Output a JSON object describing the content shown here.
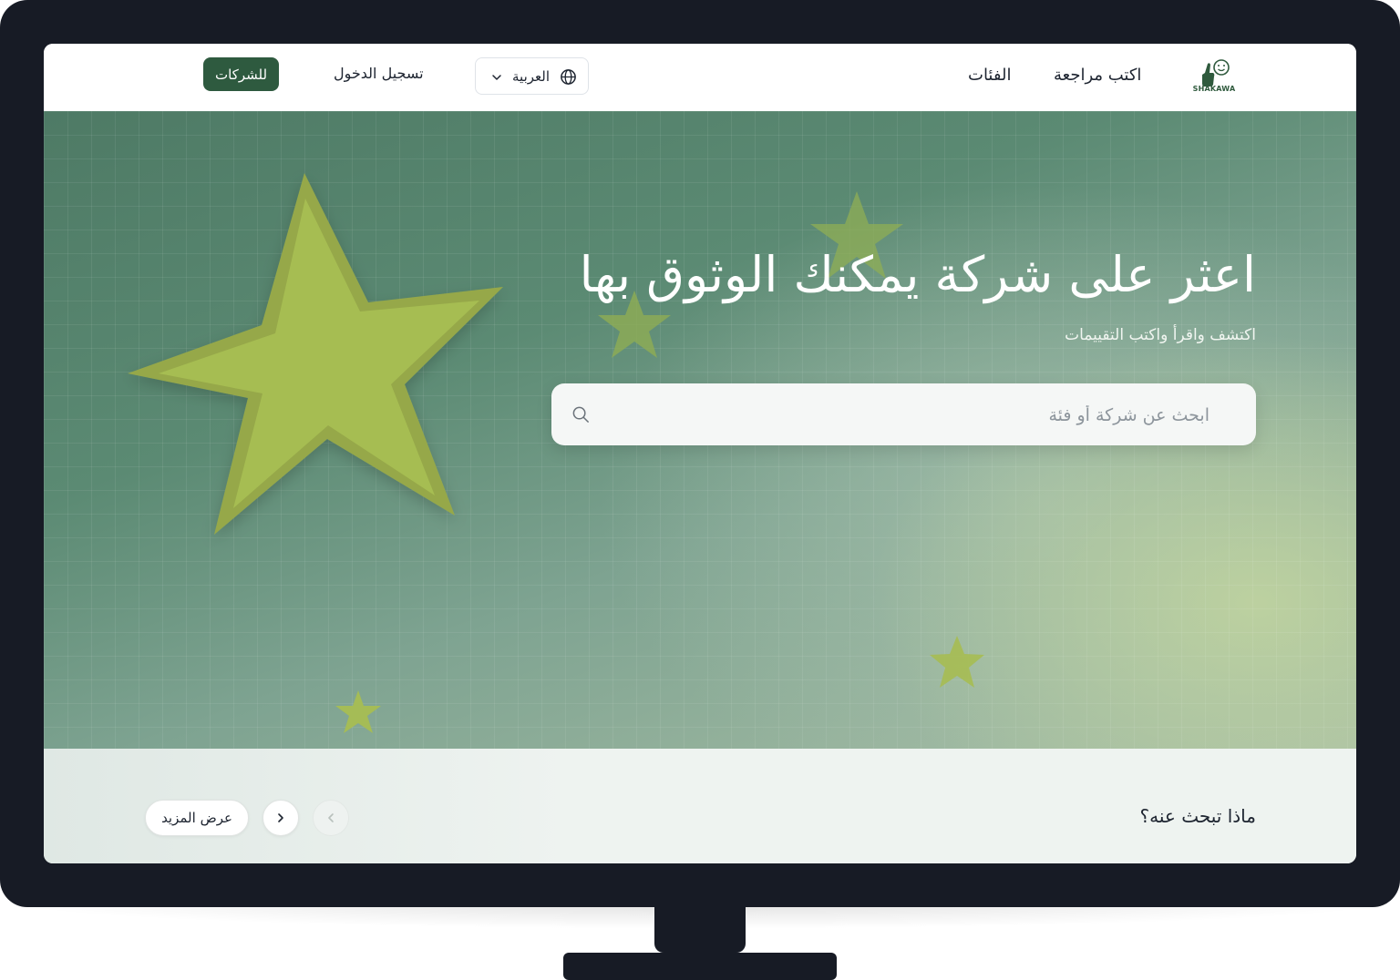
{
  "logo": {
    "text": "SHAKAWA"
  },
  "nav": {
    "write_review": "اكتب مراجعة",
    "categories": "الفئات",
    "language": "العربية",
    "login": "تسجيل الدخول",
    "for_business": "للشركات"
  },
  "hero": {
    "title": "اعثر على شركة يمكنك الوثوق بها",
    "subtitle": "اكتشف واقرأ واكتب التقييمات",
    "search_placeholder": "ابحث عن شركة أو فئة"
  },
  "section": {
    "title": "ماذا تبحث عنه؟",
    "more_label": "عرض المزيد"
  },
  "colors": {
    "brand": "#2e5a3f",
    "star": "#a6bd52",
    "monitor": "#171b25"
  },
  "icons": {
    "language": "globe-icon",
    "dropdown": "chevron-down-icon",
    "search": "search-icon",
    "next": "chevron-right-icon",
    "prev": "chevron-left-icon"
  }
}
